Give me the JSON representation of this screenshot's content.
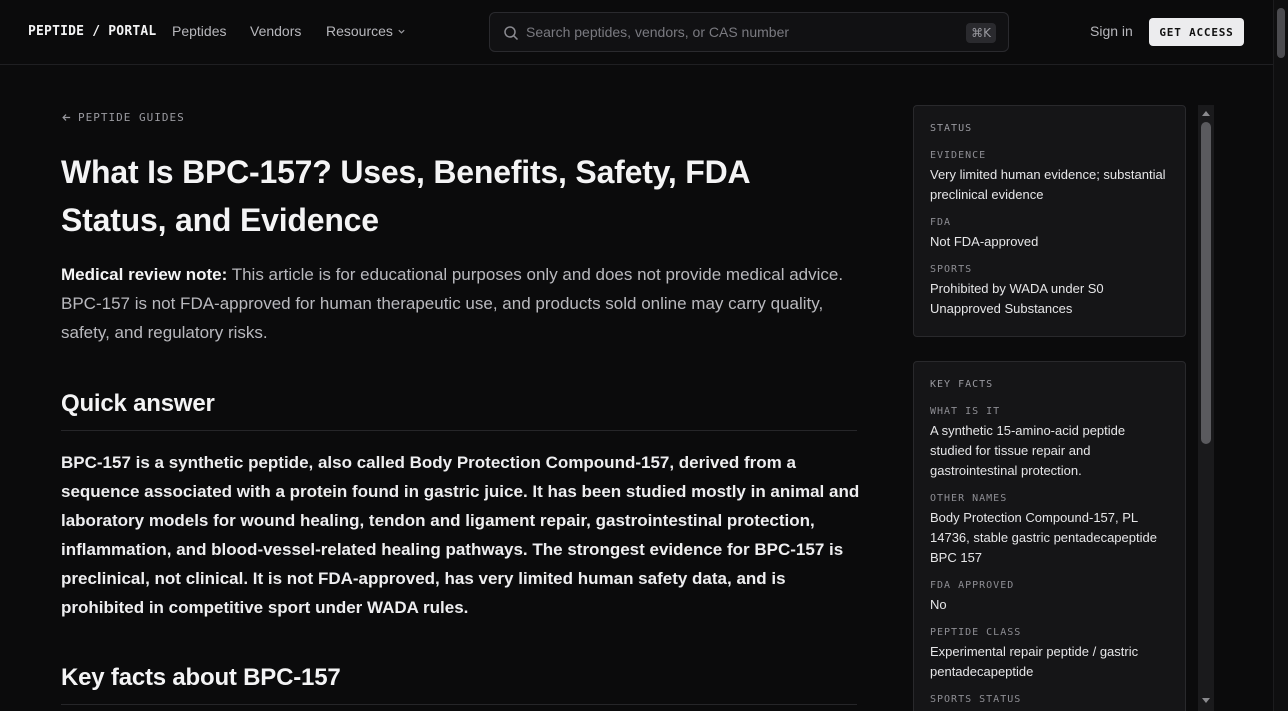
{
  "header": {
    "logo": "PEPTIDE / PORTAL",
    "nav": [
      "Peptides",
      "Vendors",
      "Resources"
    ],
    "search_placeholder": "Search peptides, vendors, or CAS number",
    "search_shortcut": "⌘K",
    "sign_in": "Sign in",
    "cta": "GET ACCESS"
  },
  "article": {
    "back_label": "PEPTIDE GUIDES",
    "title": "What Is BPC-157? Uses, Benefits, Safety, FDA Status, and Evidence",
    "review_label": "Medical review note:",
    "review_text": " This article is for educational purposes only and does not provide medical advice. BPC-157 is not FDA-approved for human therapeutic use, and products sold online may carry quality, safety, and regulatory risks.",
    "quick_answer_heading": "Quick answer",
    "quick_answer": "BPC-157 is a synthetic peptide, also called Body Protection Compound-157, derived from a sequence associated with a protein found in gastric juice. It has been studied mostly in animal and laboratory models for wound healing, tendon and ligament repair, gastrointestinal protection, inflammation, and blood-vessel-related healing pathways. The strongest evidence for BPC-157 is preclinical, not clinical. It is not FDA-approved, has very limited human safety data, and is prohibited in competitive sport under WADA rules.",
    "key_facts_heading": "Key facts about BPC-157"
  },
  "sidebar": {
    "status": {
      "heading": "STATUS",
      "items": [
        {
          "label": "EVIDENCE",
          "value": "Very limited human evidence; substantial preclinical evidence"
        },
        {
          "label": "FDA",
          "value": "Not FDA-approved"
        },
        {
          "label": "SPORTS",
          "value": "Prohibited by WADA under S0 Unapproved Substances"
        }
      ]
    },
    "facts": {
      "heading": "KEY FACTS",
      "items": [
        {
          "label": "WHAT IS IT",
          "value": "A synthetic 15-amino-acid peptide studied for tissue repair and gastrointestinal protection."
        },
        {
          "label": "OTHER NAMES",
          "value": "Body Protection Compound-157, PL 14736, stable gastric pentadecapeptide BPC 157"
        },
        {
          "label": "FDA APPROVED",
          "value": "No"
        },
        {
          "label": "PEPTIDE CLASS",
          "value": "Experimental repair peptide / gastric pentadecapeptide"
        },
        {
          "label": "SPORTS STATUS",
          "value": ""
        }
      ]
    }
  }
}
